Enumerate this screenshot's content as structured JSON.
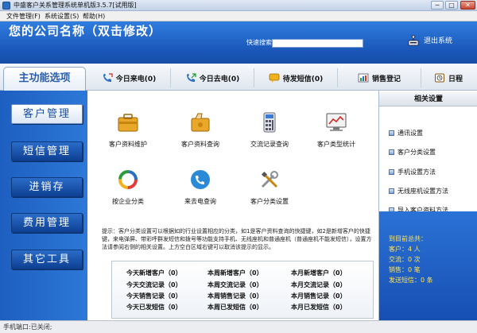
{
  "window": {
    "title": "中盛客户关系管理系统单机版3.5.7[试用版]",
    "min": "─",
    "max": "□",
    "close": "✕"
  },
  "menu": [
    "文件管理(F)",
    "系统设置(S)",
    "帮助(H)"
  ],
  "header": {
    "company_name": "您的公司名称（双击修改）",
    "search_label": "快速搜索",
    "search_value": "",
    "exit_label": "退出系统"
  },
  "tabs": {
    "function_tab": "主功能选项",
    "buttons": [
      "今日来电(0)",
      "今日去电(0)",
      "待发短信(0)",
      "销售登记",
      "日程"
    ]
  },
  "sidebar": [
    "客户管理",
    "短信管理",
    "进销存",
    "费用管理",
    "其它工具"
  ],
  "functions": [
    "客户资料维护",
    "客户资料查询",
    "交流记录查询",
    "客户类型统计",
    "按企业分类",
    "来去电查询",
    "客户分类设置"
  ],
  "tip": "提示：客户分类设置可以根据如的行业设置相应的分类，如1是客户资料查询的快捷键，如2是新增客户的快捷键，来电弹屏、带彩呼群发短信和拨号等功能支持手机、无线座机和普通座机（普通座机不能发短信），设置方法请参阅右侧的相关设置。上方空白区域右键可以取消该提示的显示。",
  "stats": [
    [
      "今天新增客户（0）",
      "本周新增客户（0）",
      "本月新增客户（0）"
    ],
    [
      "今天交流记录（0）",
      "本周交流记录（0）",
      "本月交流记录（0）"
    ],
    [
      "今天销售记录（0）",
      "本周销售记录（0）",
      "本月销售记录（0）"
    ],
    [
      "今天已发短信（0）",
      "本周已发短信（0）",
      "本月已发短信（0）"
    ]
  ],
  "right_panel": {
    "title": "相关设置",
    "items": [
      "通讯设置",
      "客户分类设置",
      "手机设置方法",
      "无线座机设置方法",
      "导入客户资料方法"
    ],
    "summary": [
      "到目前总共：",
      "客户：4 人",
      "交流：0 次",
      "销售：0 笔",
      "发送短信：0 条"
    ]
  },
  "status": "手机端口:已关闭;",
  "colors": {
    "header_blue": "#1a56b8",
    "sidebar_blue": "#1d5fc0",
    "summary_text": "#ffe35b"
  }
}
